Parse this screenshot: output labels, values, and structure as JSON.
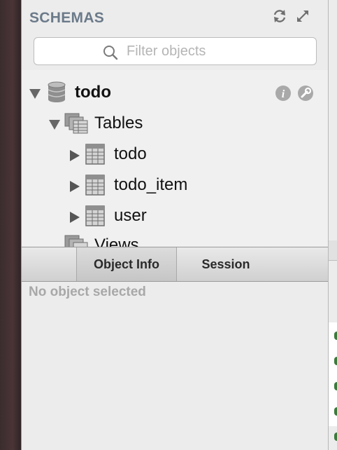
{
  "sidebar": {
    "title": "SCHEMAS",
    "header_icons": [
      "refresh-icon",
      "expand-icon"
    ],
    "filter": {
      "placeholder": "Filter objects",
      "value": ""
    }
  },
  "tree": {
    "schema": {
      "label": "todo",
      "icon": "database-icon",
      "expanded": true,
      "actions": [
        "info-icon",
        "wrench-icon"
      ]
    },
    "tables_folder": {
      "label": "Tables",
      "icon": "tables-folder-icon",
      "expanded": true
    },
    "tables": [
      {
        "label": "todo",
        "icon": "table-icon",
        "expanded": false
      },
      {
        "label": "todo_item",
        "icon": "table-icon",
        "expanded": false
      },
      {
        "label": "user",
        "icon": "table-icon",
        "expanded": false
      }
    ],
    "views_folder": {
      "label": "Views",
      "icon": "views-folder-icon"
    }
  },
  "tabs": [
    {
      "label": "Object Info",
      "selected": true
    },
    {
      "label": "Session",
      "selected": false
    }
  ],
  "info_pane": {
    "empty_text": "No object selected"
  },
  "colors": {
    "title": "#6b7a8a",
    "placeholder": "#b5b5b5",
    "empty_text": "#a8a8a8"
  }
}
